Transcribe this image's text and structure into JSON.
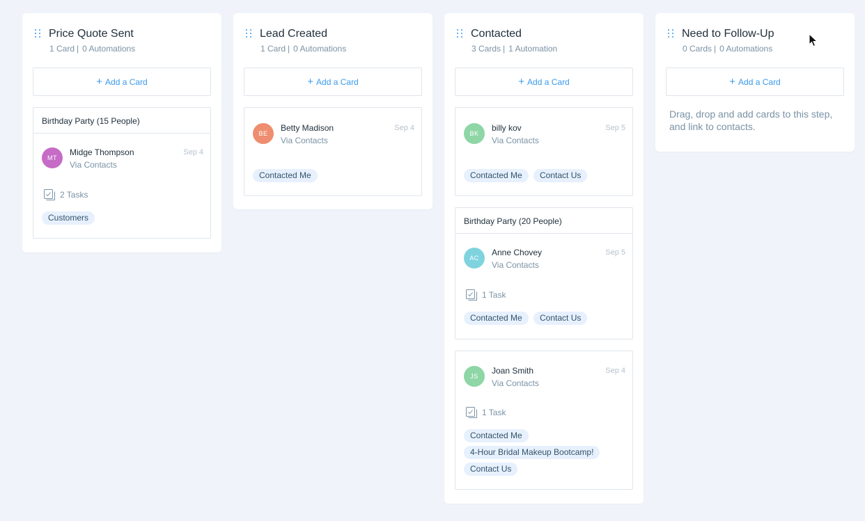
{
  "columns": [
    {
      "title": "Price Quote Sent",
      "cards_count": "1 Card",
      "automations": "0 Automations",
      "add_card_label": "Add a Card",
      "cards": [
        {
          "deal_title": "Birthday Party (15 People)",
          "contact": {
            "initials": "MT",
            "name": "Midge Thompson",
            "source": "Via Contacts",
            "date": "Sep 4",
            "avatar_color": "#c66bc6"
          },
          "tasks": "2 Tasks",
          "tags": [
            "Customers"
          ]
        }
      ]
    },
    {
      "title": "Lead Created",
      "cards_count": "1 Card",
      "automations": "0 Automations",
      "add_card_label": "Add a Card",
      "cards": [
        {
          "contact": {
            "initials": "BE",
            "name": "Betty Madison",
            "source": "Via Contacts",
            "date": "Sep 4",
            "avatar_color": "#ee8d6f"
          },
          "tags": [
            "Contacted Me"
          ]
        }
      ]
    },
    {
      "title": "Contacted",
      "cards_count": "3 Cards",
      "automations": "1 Automation",
      "add_card_label": "Add a Card",
      "cards": [
        {
          "contact": {
            "initials": "BK",
            "name": "billy kov",
            "source": "Via Contacts",
            "date": "Sep 5",
            "avatar_color": "#8ed6a6"
          },
          "tags": [
            "Contacted Me",
            "Contact Us"
          ]
        },
        {
          "deal_title": "Birthday Party (20 People)",
          "contact": {
            "initials": "AC",
            "name": "Anne Chovey",
            "source": "Via Contacts",
            "date": "Sep 5",
            "avatar_color": "#7fd3de"
          },
          "tasks": "1 Task",
          "tags": [
            "Contacted Me",
            "Contact Us"
          ]
        },
        {
          "contact": {
            "initials": "JS",
            "name": "Joan Smith",
            "source": "Via Contacts",
            "date": "Sep 4",
            "avatar_color": "#8ed6a6"
          },
          "tasks": "1 Task",
          "tags": [
            "Contacted Me",
            "4-Hour Bridal Makeup Bootcamp!",
            "Contact Us"
          ]
        }
      ]
    },
    {
      "title": "Need to Follow-Up",
      "cards_count": "0 Cards",
      "automations": "0 Automations",
      "add_card_label": "Add a Card",
      "empty_hint": "Drag, drop and add cards to this step, and link to contacts.",
      "cards": []
    }
  ],
  "icons": {
    "drag_handle": "drag-handle-icon",
    "add": "plus-icon",
    "tasks": "task-checkbox-icon",
    "cursor": "mouse-pointer-icon"
  },
  "colors": {
    "background": "#f0f4fa",
    "accent": "#3899ec",
    "tag_background": "#e7f0fd"
  }
}
